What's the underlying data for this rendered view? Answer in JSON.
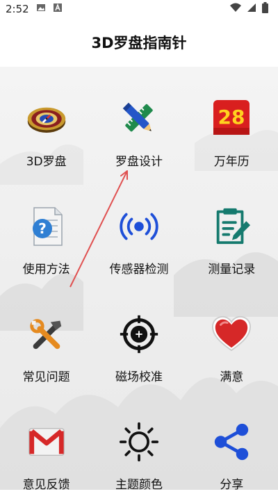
{
  "status": {
    "time": "2:52"
  },
  "app": {
    "title": "3D罗盘指南针"
  },
  "calendar_day": "28",
  "grid": [
    {
      "label": "3D罗盘",
      "icon": "compass-icon"
    },
    {
      "label": "罗盘设计",
      "icon": "pencil-ruler-icon"
    },
    {
      "label": "万年历",
      "icon": "calendar-icon"
    },
    {
      "label": "使用方法",
      "icon": "help-document-icon"
    },
    {
      "label": "传感器检测",
      "icon": "sensor-signal-icon"
    },
    {
      "label": "测量记录",
      "icon": "clipboard-edit-icon"
    },
    {
      "label": "常见问题",
      "icon": "tools-icon"
    },
    {
      "label": "磁场校准",
      "icon": "crosshair-icon"
    },
    {
      "label": "满意",
      "icon": "heart-icon"
    },
    {
      "label": "意见反馈",
      "icon": "gmail-icon"
    },
    {
      "label": "主题颜色",
      "icon": "sun-icon"
    },
    {
      "label": "分享",
      "icon": "share-icon"
    }
  ],
  "colors": {
    "accent_blue": "#1E4FD8",
    "red": "#D62828",
    "arrow": "#E05050"
  }
}
